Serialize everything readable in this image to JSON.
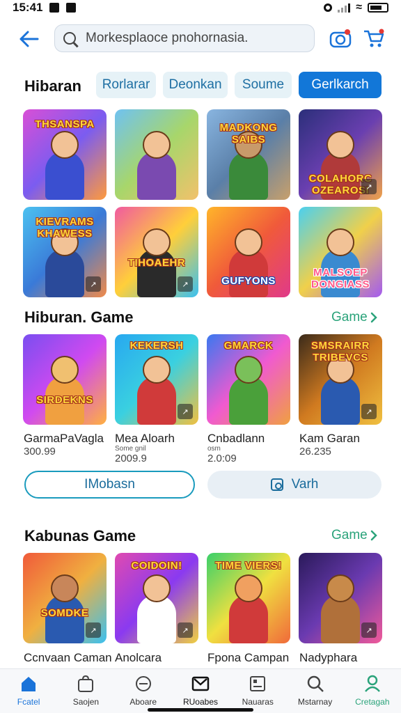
{
  "status_bar": {
    "time": "15:41"
  },
  "header": {
    "search_placeholder": "Morkesplaoce pnohornasia."
  },
  "section_main": {
    "title": "Hibaran",
    "chips": [
      "Rorlarar",
      "Deonkan",
      "Soume",
      "Gerlkarch"
    ],
    "tiles": [
      {
        "label": "THSANSPA",
        "bg": "linear-gradient(135deg,#d94fd6,#7b5cf0,#ff9a3c)"
      },
      {
        "label": "",
        "bg": "linear-gradient(135deg,#6fc2f2,#a7d66b,#f2c16b)"
      },
      {
        "label": "MADKONG SAIBS",
        "bg": "linear-gradient(135deg,#89b5e0,#5a7fa8,#c8a06b)"
      },
      {
        "label": "COLAHORC OZEAROSI",
        "bg": "linear-gradient(135deg,#2b2f7a,#6a3fb0,#f0a24a)"
      },
      {
        "label": "KIEVRAMS KHAWESS",
        "bg": "linear-gradient(135deg,#4cc1f0,#3a7ad8,#f08a4a)"
      },
      {
        "label": "TIHOAEHR",
        "bg": "linear-gradient(135deg,#f05aa0,#ffcf3a,#3ac0f0)"
      },
      {
        "label": "GUFYONS",
        "bg": "linear-gradient(135deg,#ffb52a,#f05a3a,#e03a8a)"
      },
      {
        "label": "MALSOEP DONGIASS",
        "bg": "linear-gradient(135deg,#4ad0f0,#f0d04a,#a35af0)"
      }
    ]
  },
  "section_game": {
    "title": "Hiburan. Game",
    "see_all": "Game",
    "cards": [
      {
        "label": "SIRDEKNS",
        "name": "GarmaPaVagla",
        "sub": "",
        "price": "300.99",
        "bg": "linear-gradient(135deg,#7a4ef0,#d04af0,#ffb040)"
      },
      {
        "label": "KEKERSH",
        "name": "Mea Aloarh",
        "sub": "Some gnil",
        "price": "2009.9",
        "bg": "linear-gradient(135deg,#28a8f0,#3ad0e0,#f0c040)"
      },
      {
        "label": "GMARCK",
        "name": "Cnbadlann",
        "sub": "osm",
        "price": "2.0:09",
        "bg": "linear-gradient(135deg,#3a78f0,#f05ad0,#f0a040)"
      },
      {
        "label": "SMSRAIRR TRIBEVCS",
        "name": "Kam Garan",
        "sub": "",
        "price": "26.235",
        "bg": "linear-gradient(135deg,#3a2a1a,#d07a20,#f0c040)"
      }
    ],
    "button_left": "IMobasn",
    "button_right": "Varh"
  },
  "section_kabunas": {
    "title": "Kabunas Game",
    "see_all": "Game",
    "cards": [
      {
        "label": "SOMDKE",
        "name": "Ccnvaan Caman",
        "bg": "linear-gradient(135deg,#f05a3a,#f0b040,#3ac0f0)"
      },
      {
        "label": "COIDOIN!",
        "name": "Anolcara",
        "bg": "linear-gradient(135deg,#e04ab0,#8a3af0,#f0d040)"
      },
      {
        "label": "TIME VIERS!",
        "name": "Fpona Campan",
        "bg": "linear-gradient(135deg,#3ad06a,#f0e040,#f06a3a)"
      },
      {
        "label": "",
        "name": "Nadyphara",
        "bg": "linear-gradient(135deg,#2a1a5a,#6a3ab0,#f05a9a)"
      }
    ]
  },
  "bottom_nav": [
    "Fcatel",
    "Saojen",
    "Aboare",
    "RUoabes",
    "Nauaras",
    "Mstarnay",
    "Cretagah"
  ],
  "colors": {
    "accent_blue": "#1277d8",
    "accent_green": "#2aa37a"
  }
}
